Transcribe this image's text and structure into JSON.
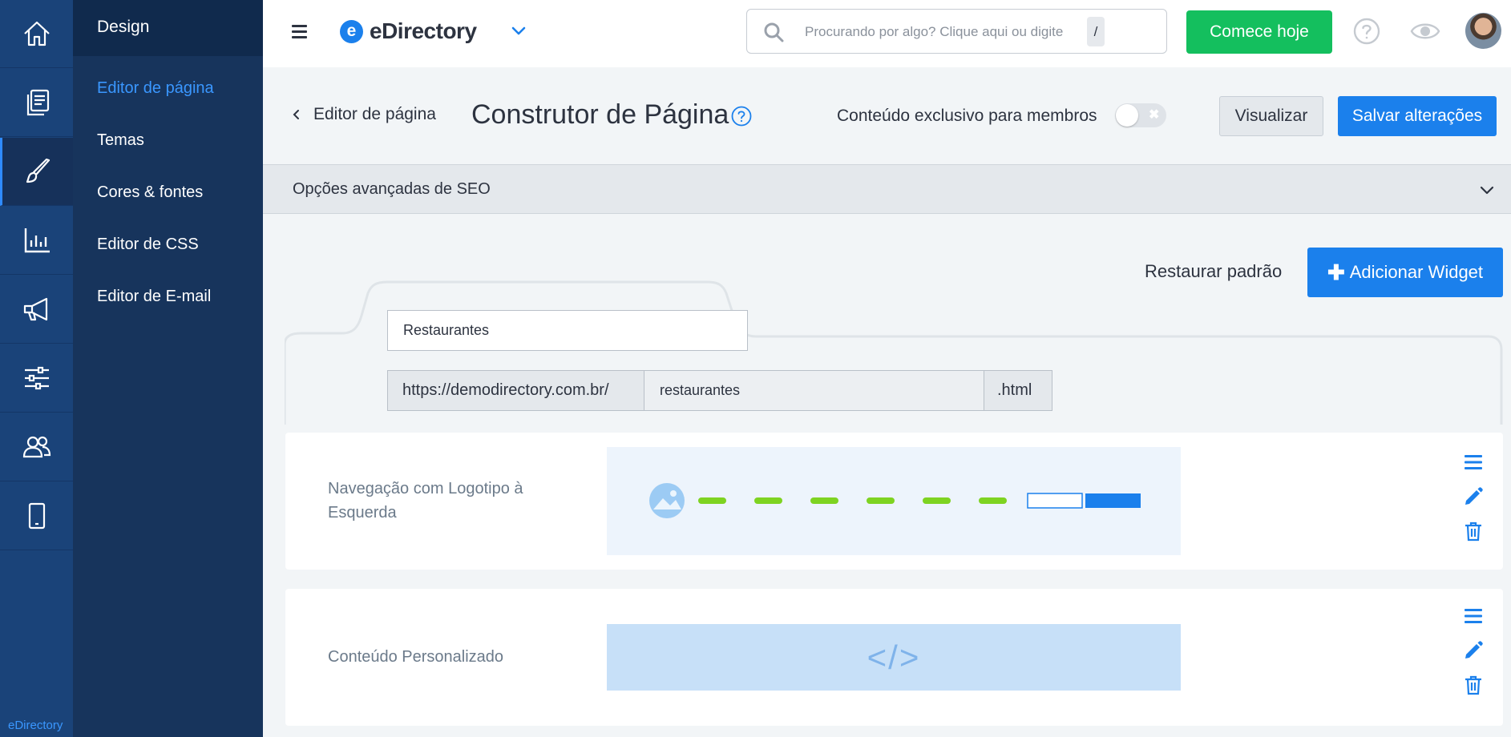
{
  "sidebar": {
    "brand": "eDirectory",
    "icons": [
      "home-icon",
      "pages-icon",
      "paintbrush-icon",
      "chart-icon",
      "megaphone-icon",
      "sliders-icon",
      "users-icon",
      "mobile-icon"
    ],
    "active": "paintbrush-icon"
  },
  "submenu": {
    "title": "Design",
    "items": [
      {
        "label": "Editor de página",
        "active": true
      },
      {
        "label": "Temas"
      },
      {
        "label": "Cores & fontes"
      },
      {
        "label": "Editor de CSS"
      },
      {
        "label": "Editor de E-mail"
      }
    ]
  },
  "topbar": {
    "logo_mark": "e",
    "logo_text": "eDirectory",
    "search_placeholder": "Procurando por algo? Clique aqui ou digite",
    "search_shortcut": "/",
    "start_label": "Comece hoje"
  },
  "page": {
    "back_label": "Editor de página",
    "title": "Construtor de Página",
    "members_label": "Conteúdo exclusivo para membros",
    "members_toggle_on": false,
    "toggle_symbol": "✖",
    "preview_label": "Visualizar",
    "save_label": "Salvar alterações"
  },
  "seo": {
    "label": "Opções avançadas de SEO"
  },
  "actions": {
    "restore_label": "Restaurar padrão",
    "add_widget_plus": "✚",
    "add_widget_label": "Adicionar Widget"
  },
  "page_settings": {
    "name_value": "Restaurantes",
    "url_prefix": "https://demodirectory.com.br/",
    "url_slug": "restaurantes",
    "url_suffix": ".html"
  },
  "widgets": [
    {
      "label": "Navegação com Logotipo à Esquerda",
      "preview": "navigation-with-logo"
    },
    {
      "label": "Conteúdo Personalizado",
      "preview": "custom-code",
      "preview_glyph": "</>"
    }
  ],
  "colors": {
    "rail": "#1a4379",
    "submenu": "#17345c",
    "primary": "#1b80ec",
    "success": "#14bf5e",
    "nav_dash": "#7ed321"
  }
}
